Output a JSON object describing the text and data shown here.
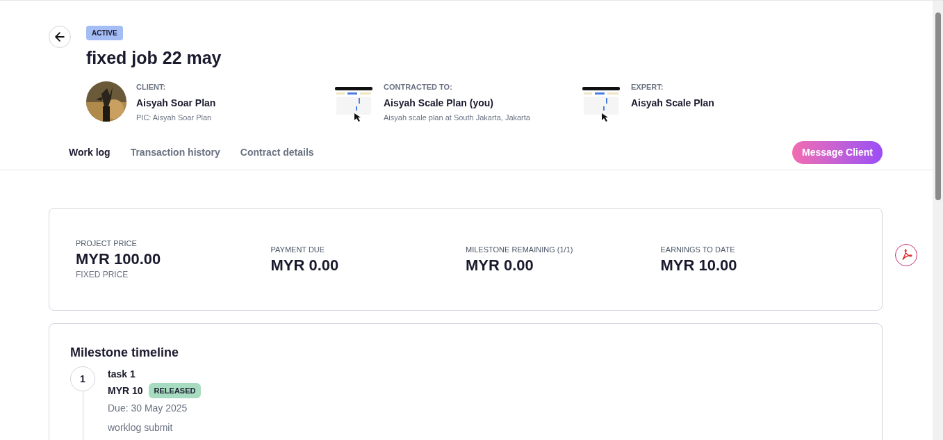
{
  "status_badge": "ACTIVE",
  "title": "fixed job 22 may",
  "parties": [
    {
      "label": "CLIENT:",
      "name": "Aisyah Soar Plan",
      "detail": "PIC: Aisyah Soar Plan"
    },
    {
      "label": "CONTRACTED TO:",
      "name": "Aisyah Scale Plan (you)",
      "detail": "Aisyah scale plan at South Jakarta, Jakarta"
    },
    {
      "label": "EXPERT:",
      "name": "Aisyah Scale Plan"
    }
  ],
  "tabs": [
    {
      "label": "Work log",
      "selected": true
    },
    {
      "label": "Transaction history",
      "selected": false
    },
    {
      "label": "Contract details",
      "selected": false
    }
  ],
  "message_button": "Message Client",
  "stats": [
    {
      "label": "PROJECT PRICE",
      "value": "MYR 100.00",
      "note": "FIXED PRICE"
    },
    {
      "label": "PAYMENT DUE",
      "value": "MYR 0.00"
    },
    {
      "label": "MILESTONE REMAINING (1/1)",
      "value": "MYR 0.00"
    },
    {
      "label": "EARNINGS TO DATE",
      "value": "MYR 10.00"
    }
  ],
  "milestone_timeline": {
    "title": "Milestone timeline",
    "milestones": [
      {
        "number": "1",
        "name": "task 1",
        "amount": "MYR 10",
        "status": "RELEASED",
        "due": "Due: 30 May 2025",
        "worklog": "worklog submit"
      }
    ]
  }
}
